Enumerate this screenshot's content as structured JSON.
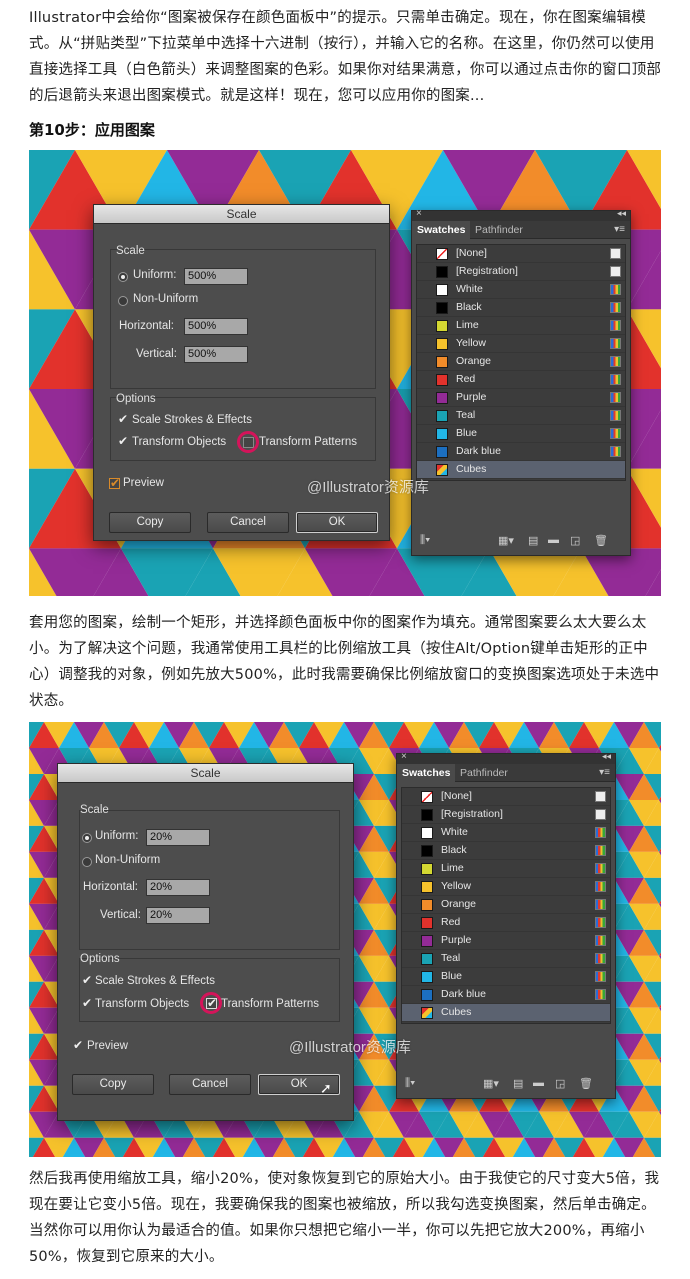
{
  "intro_text": "Illustrator中会给你“图案被保存在颜色面板中”的提示。只需单击确定。现在，你在图案编辑模式。从“拼贴类型”下拉菜单中选择十六进制（按行），并输入它的名称。在这里，你仍然可以使用直接选择工具（白色箭头）来调整图案的色彩。如果你对结果满意，你可以通过点击你的窗口顶部的后退箭头来退出图案模式。就是这样！现在，您可以应用你的图案...",
  "step_title": "第10步：应用图案",
  "middle_text": "套用您的图案，绘制一个矩形，并选择颜色面板中你的图案作为填充。通常图案要么太大要么太小。为了解决这个问题，我通常使用工具栏的比例缩放工具（按住Alt/Option键单击矩形的正中心）调整我的对象，例如先放大500%，此时我需要确保比例缩放窗口的变换图案选项处于未选中状态。",
  "final_text": "然后我再使用缩放工具，缩小20%，使对象恢复到它的原始大小。由于我使它的尺寸变大5倍，我现在要让它变小5倍。现在，我要确保我的图案也被缩放，所以我勾选变换图案，然后单击确定。当然你可以用你认为最适合的值。如果你只想把它缩小一半，你可以先把它放大200%，再缩小50%，恢复到它原来的大小。",
  "watermark": "@Illustrator资源库",
  "dialog1": {
    "title": "Scale",
    "scale_group": "Scale",
    "uniform_label": "Uniform:",
    "uniform_value": "500%",
    "nonuniform_label": "Non-Uniform",
    "horizontal_label": "Horizontal:",
    "horizontal_value": "500%",
    "vertical_label": "Vertical:",
    "vertical_value": "500%",
    "options_group": "Options",
    "scale_strokes_label": "Scale Strokes & Effects",
    "transform_objects_label": "Transform Objects",
    "transform_patterns_label": "Transform Patterns",
    "transform_patterns_checked": false,
    "preview_label": "Preview",
    "copy_label": "Copy",
    "cancel_label": "Cancel",
    "ok_label": "OK"
  },
  "dialog2": {
    "title": "Scale",
    "scale_group": "Scale",
    "uniform_label": "Uniform:",
    "uniform_value": "20%",
    "nonuniform_label": "Non-Uniform",
    "horizontal_label": "Horizontal:",
    "horizontal_value": "20%",
    "vertical_label": "Vertical:",
    "vertical_value": "20%",
    "options_group": "Options",
    "scale_strokes_label": "Scale Strokes & Effects",
    "transform_objects_label": "Transform Objects",
    "transform_patterns_label": "Transform Patterns",
    "transform_patterns_checked": true,
    "preview_label": "Preview",
    "copy_label": "Copy",
    "cancel_label": "Cancel",
    "ok_label": "OK"
  },
  "swatches_panel": {
    "close_glyph": "×",
    "collapse_glyph": "◂◂",
    "tab_swatches": "Swatches",
    "tab_pathfinder": "Pathfinder",
    "swatches": [
      {
        "name": "[None]",
        "color": "#ffffff",
        "kind": "none"
      },
      {
        "name": "[Registration]",
        "color": "#000000",
        "kind": "reg"
      },
      {
        "name": "White",
        "color": "#ffffff",
        "kind": "proc"
      },
      {
        "name": "Black",
        "color": "#000000",
        "kind": "proc"
      },
      {
        "name": "Lime",
        "color": "#d4d832",
        "kind": "proc"
      },
      {
        "name": "Yellow",
        "color": "#f6c22c",
        "kind": "proc"
      },
      {
        "name": "Orange",
        "color": "#f28c2a",
        "kind": "proc"
      },
      {
        "name": "Red",
        "color": "#e2322c",
        "kind": "proc"
      },
      {
        "name": "Purple",
        "color": "#932b96",
        "kind": "proc"
      },
      {
        "name": "Teal",
        "color": "#1aa3b4",
        "kind": "proc"
      },
      {
        "name": "Blue",
        "color": "#22b6e6",
        "kind": "proc"
      },
      {
        "name": "Dark blue",
        "color": "#1c6fc0",
        "kind": "proc"
      },
      {
        "name": "Cubes",
        "color": "#f06a3a",
        "kind": "pattern",
        "selected": true
      }
    ]
  },
  "colors": {
    "pattern": [
      "#e2322c",
      "#f6c22c",
      "#22b6e6",
      "#932b96",
      "#f28c2a",
      "#1aa3b4"
    ]
  }
}
